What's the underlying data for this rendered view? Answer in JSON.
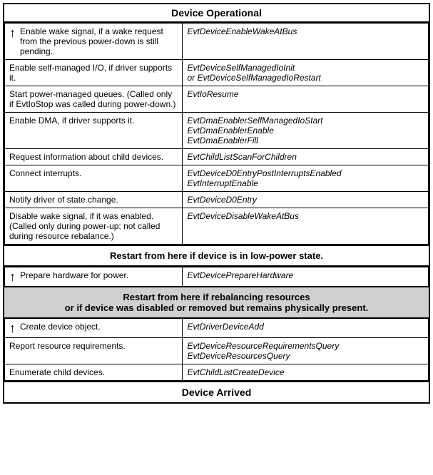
{
  "header": {
    "top_title": "Device Operational",
    "bottom_title": "Device Arrived"
  },
  "banners": {
    "low_power": "Restart from here if device is in low-power state.",
    "rebalance": "Restart from here if rebalancing resources\nor if device was disabled or removed but remains physically present."
  },
  "rows": [
    {
      "left": "Enable wake signal, if a wake request from the previous power-down is still pending.",
      "right": "EvtDeviceEnableWakeAtBus",
      "has_arrow": true
    },
    {
      "left": "Enable self-managed I/O, if driver supports it.",
      "right": "EvtDeviceSelfManagedIoInit\nor EvtDeviceSelfManagedIoRestart",
      "has_arrow": false
    },
    {
      "left": "Start power-managed queues. (Called only if EvtIoStop was called during power-down.)",
      "right": "EvtIoResume",
      "has_arrow": false
    },
    {
      "left": "Enable DMA, if driver supports it.",
      "right": "EvtDmaEnablerSelfManagedIoStart\nEvtDmaEnablerEnable\nEvtDmaEnablerFill",
      "has_arrow": false
    },
    {
      "left": "Request information about child devices.",
      "right": "EvtChildListScanForChildren",
      "has_arrow": false
    },
    {
      "left": "Connect interrupts.",
      "right": "EvtDeviceD0EntryPostInterruptsEnabled\nEvtInterruptEnable",
      "has_arrow": false
    },
    {
      "left": "Notify driver of state change.",
      "right": "EvtDeviceD0Entry",
      "has_arrow": false
    },
    {
      "left": "Disable wake signal, if it was enabled. (Called only during power-up; not called during resource rebalance.)",
      "right": "EvtDeviceDisableWakeAtBus",
      "has_arrow": false
    }
  ],
  "middle_rows": [
    {
      "left": "Prepare hardware for power.",
      "right": "EvtDevicePrepareHardware",
      "has_arrow": true
    }
  ],
  "bottom_rows": [
    {
      "left": "Create device object.",
      "right": "EvtDriverDeviceAdd",
      "has_arrow": true
    },
    {
      "left": "Report resource requirements.",
      "right": "EvtDeviceResourceRequirementsQuery\nEvtDeviceResourcesQuery",
      "has_arrow": false
    },
    {
      "left": "Enumerate child devices.",
      "right": "EvtChildListCreateDevice",
      "has_arrow": false
    }
  ]
}
